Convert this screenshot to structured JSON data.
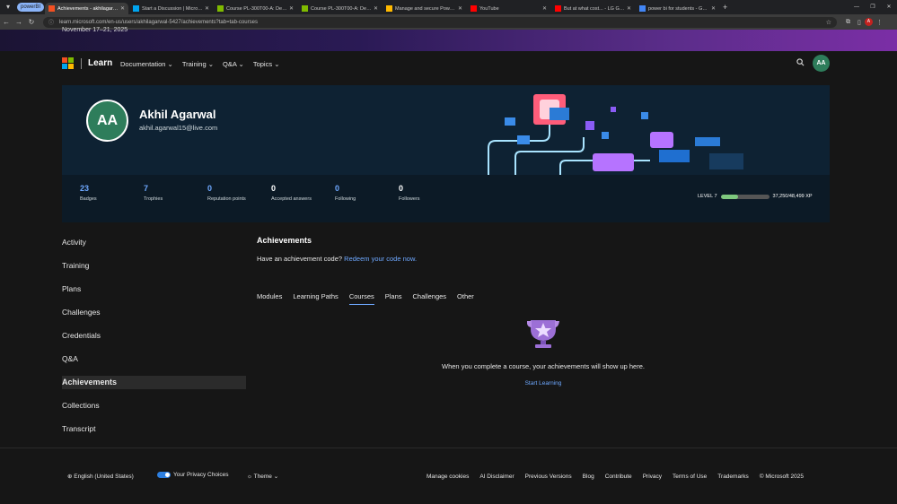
{
  "browser": {
    "group_chip": "powerBI",
    "tabs": [
      {
        "title": "Achievements - akhilagarwal-5...",
        "favicon_color": "#f25022",
        "active": true
      },
      {
        "title": "Start a Discussion | Microsoft...",
        "favicon_color": "#00a4ef",
        "active": false
      },
      {
        "title": "Course PL-300T00-A: Design a...",
        "favicon_color": "#7fba00",
        "active": false
      },
      {
        "title": "Course PL-300T00-A: Design a...",
        "favicon_color": "#7fba00",
        "active": false
      },
      {
        "title": "Manage and secure Power BI -...",
        "favicon_color": "#ffb900",
        "active": false
      },
      {
        "title": "YouTube",
        "favicon_color": "#ff0000",
        "active": false
      },
      {
        "title": "But at what cost... - LG G07 - Yo...",
        "favicon_color": "#ff0000",
        "active": false
      },
      {
        "title": "power bi for students - Google...",
        "favicon_color": "#4285f4",
        "active": false
      }
    ],
    "url": "learn.microsoft.com/en-us/users/akhilagarwal-5427/achievements?tab=tab-courses",
    "profile_initial": "A"
  },
  "banner": {
    "date": "November 17–21, 2025"
  },
  "nav": {
    "brand": "Learn",
    "items": [
      "Documentation",
      "Training",
      "Q&A",
      "Topics"
    ],
    "avatar_initials": "AA"
  },
  "profile": {
    "initials": "AA",
    "name": "Akhil Agarwal",
    "email": "akhil.agarwal15@live.com",
    "stats": [
      {
        "value": "23",
        "label": "Badges",
        "accent": true
      },
      {
        "value": "7",
        "label": "Trophies",
        "accent": true
      },
      {
        "value": "0",
        "label": "Reputation points",
        "accent": true
      },
      {
        "value": "0",
        "label": "Accepted answers",
        "accent": false
      },
      {
        "value": "0",
        "label": "Following",
        "accent": true
      },
      {
        "value": "0",
        "label": "Followers",
        "accent": false
      }
    ],
    "level_label": "LEVEL 7",
    "xp_text": "37,250/48,499 XP",
    "level_progress": 0.3557
  },
  "sidebar": {
    "items": [
      "Activity",
      "Training",
      "Plans",
      "Challenges",
      "Credentials",
      "Q&A",
      "Achievements",
      "Collections",
      "Transcript"
    ],
    "active": "Achievements"
  },
  "main": {
    "heading": "Achievements",
    "code_prompt": "Have an achievement code?",
    "code_link": "Redeem your code now.",
    "tabs": [
      "Modules",
      "Learning Paths",
      "Courses",
      "Plans",
      "Challenges",
      "Other"
    ],
    "active_tab": "Courses",
    "empty_message": "When you complete a course, your achievements will show up here.",
    "empty_link": "Start Learning"
  },
  "footer": {
    "locale": "English (United States)",
    "privacy": "Your Privacy Choices",
    "theme": "Theme",
    "links": [
      "Manage cookies",
      "AI Disclaimer",
      "Previous Versions",
      "Blog",
      "Contribute",
      "Privacy",
      "Terms of Use",
      "Trademarks",
      "© Microsoft 2025"
    ]
  },
  "colors": {
    "accent": "#6ea8ff",
    "avatar": "#2e7d5b",
    "xp_fill": "#7ec87e"
  }
}
